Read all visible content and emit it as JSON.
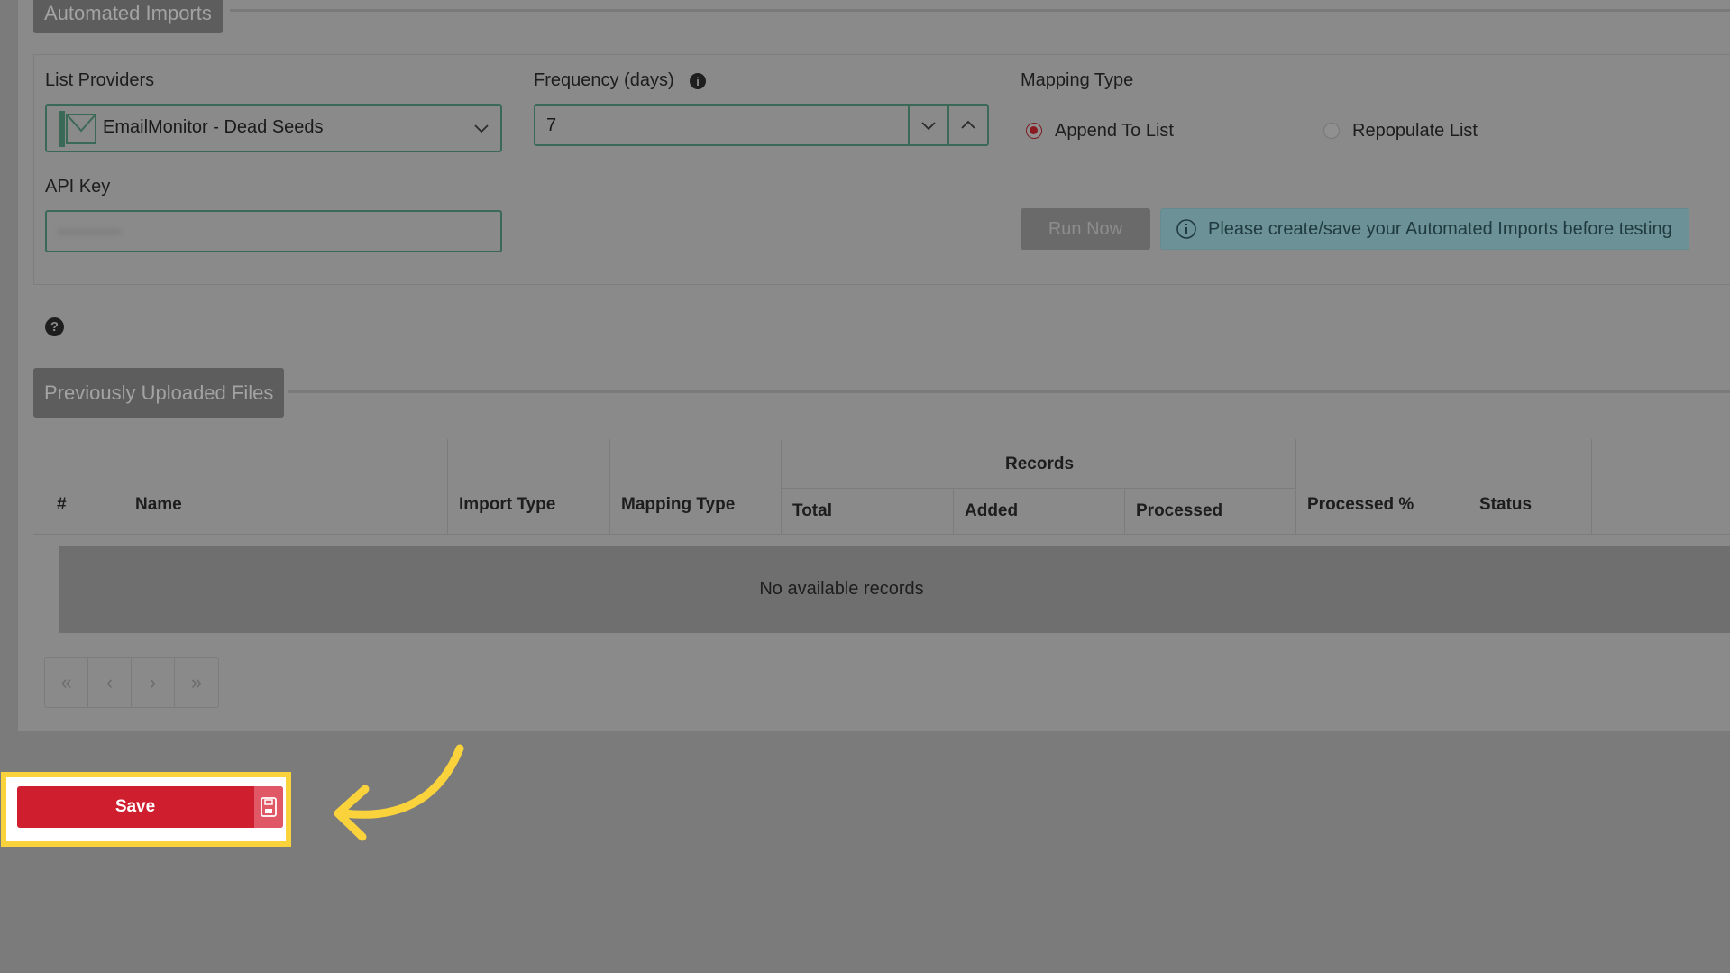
{
  "automated_imports": {
    "tab_label": "Automated Imports",
    "list_providers": {
      "label": "List Providers",
      "selected": "EmailMonitor - Dead Seeds"
    },
    "frequency": {
      "label": "Frequency (days)",
      "value": "7"
    },
    "mapping_type": {
      "label": "Mapping Type",
      "options": [
        {
          "label": "Append To List",
          "selected": true
        },
        {
          "label": "Repopulate List",
          "selected": false
        }
      ]
    },
    "api_key": {
      "label": "API Key",
      "value": "••••••••••"
    },
    "run_now_label": "Run Now",
    "alert_text": "Please create/save your Automated Imports before testing"
  },
  "previous_files": {
    "tab_label": "Previously Uploaded Files",
    "columns": {
      "index": "#",
      "name": "Name",
      "import_type": "Import Type",
      "mapping_type": "Mapping Type",
      "records": "Records",
      "total": "Total",
      "added": "Added",
      "processed": "Processed",
      "processed_pct": "Processed %",
      "status": "Status"
    },
    "empty_text": "No available records",
    "pager": [
      "«",
      "‹",
      "›",
      "»"
    ]
  },
  "save_label": "Save",
  "colors": {
    "primary_red": "#cf1f2e",
    "highlight_yellow": "#f9d23c",
    "field_border": "#3a6a57"
  }
}
